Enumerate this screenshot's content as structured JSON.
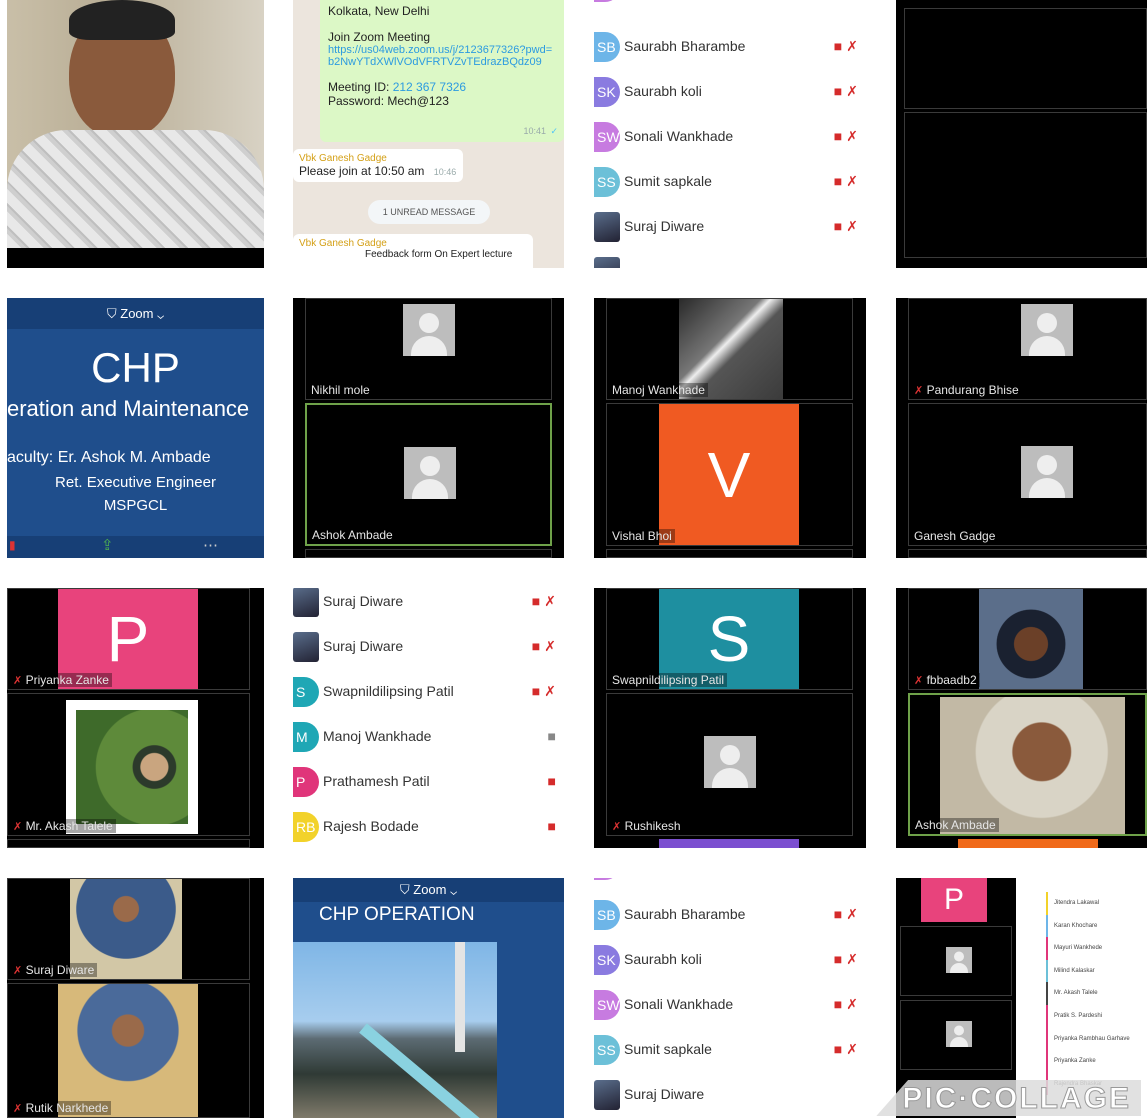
{
  "r1": {
    "chat": {
      "location": "Kolkata, New Delhi",
      "join": "Join Zoom Meeting",
      "link": "https://us04web.zoom.us/j/2123677326?pwd=b2NwYTdXWlVOdVFRTVZvTEdrazBQdz09",
      "meeting_id_label": "Meeting ID:",
      "meeting_id": "212 367 7326",
      "password": "Password: Mech@123",
      "bubble_time": "10:41",
      "sender": "Vbk Ganesh Gadge",
      "message": "Please join at 10:50 am",
      "message_time": "10:46",
      "unread": "1 UNREAD MESSAGE",
      "sender2": "Vbk Ganesh Gadge",
      "message2": "Feedback form On Expert lecture"
    },
    "list": [
      {
        "initials": "SB",
        "name": "Saurabh Bharambe",
        "color": "#6db5e8"
      },
      {
        "initials": "SK",
        "name": "Saurabh koli",
        "color": "#8a7be0"
      },
      {
        "initials": "SW",
        "name": "Sonali Wankhade",
        "color": "#c77be0"
      },
      {
        "initials": "SS",
        "name": "Sumit sapkale",
        "color": "#6cc0d8"
      },
      {
        "initials": "",
        "name": "Suraj Diware",
        "color": "#4a5d80"
      }
    ]
  },
  "r2": {
    "slide": {
      "zoom": "Zoom",
      "title": "CHP",
      "subtitle": "eration and Maintenance",
      "faculty": "aculty: Er. Ashok M. Ambade",
      "role": "Ret. Executive Engineer",
      "org": "MSPGCL"
    },
    "g2": [
      "Nikhil mole",
      "Ashok Ambade"
    ],
    "g3": [
      "Manoj Wankhade",
      "Vishal Bhoi"
    ],
    "g3_letter": "V",
    "g4": [
      "Pandurang Bhise",
      "Ganesh Gadge"
    ]
  },
  "r3": {
    "g1": [
      "Priyanka Zanke",
      "Mr. Akash Talele"
    ],
    "g1_letter": "P",
    "list": [
      {
        "initials": "",
        "name": "Suraj Diware",
        "color": "#4a5d80",
        "icons": "both"
      },
      {
        "initials": "",
        "name": "Suraj Diware",
        "color": "#4a5d80",
        "icons": "both"
      },
      {
        "initials": "S",
        "name": "Swapnildilipsing Patil",
        "color": "#1fa7b5",
        "icons": "both"
      },
      {
        "initials": "M",
        "name": "Manoj Wankhade",
        "color": "#1fa7b5",
        "icons": "video"
      },
      {
        "initials": "P",
        "name": "Prathamesh Patil",
        "color": "#e0357a",
        "icons": "videooff"
      },
      {
        "initials": "RB",
        "name": "Rajesh Bodade",
        "color": "#f2d22a",
        "icons": "videooff"
      }
    ],
    "g3": [
      "Swapnildilipsing Patil",
      "Rushikesh"
    ],
    "g3_letter": "S",
    "g4": [
      "fbbaadb2",
      "Ashok Ambade"
    ]
  },
  "r4": {
    "g1": [
      "Suraj Diware",
      "Rutik Narkhede"
    ],
    "slide": {
      "zoom": "Zoom",
      "title": "CHP OPERATION"
    },
    "list": [
      {
        "initials": "SB",
        "name": "Saurabh Bharambe",
        "color": "#6db5e8"
      },
      {
        "initials": "SK",
        "name": "Saurabh koli",
        "color": "#8a7be0"
      },
      {
        "initials": "SW",
        "name": "Sonali Wankhade",
        "color": "#c77be0"
      },
      {
        "initials": "SS",
        "name": "Sumit sapkale",
        "color": "#6cc0d8"
      },
      {
        "initials": "",
        "name": "Suraj Diware",
        "color": "#4a5d80"
      }
    ],
    "mini_letter": "P",
    "mini_list": [
      "Jitendra Lakawal",
      "Karan Khochare",
      "Mayuri Wankhede",
      "Milind Kalaskar",
      "Mr. Akash Talele",
      "Pratik S. Pardeshi",
      "Priyanka Rambhau Garhave",
      "Priyanka Zanke",
      "Rajendra Bhaskar"
    ],
    "watermark": "PIC·COLLAGE"
  }
}
